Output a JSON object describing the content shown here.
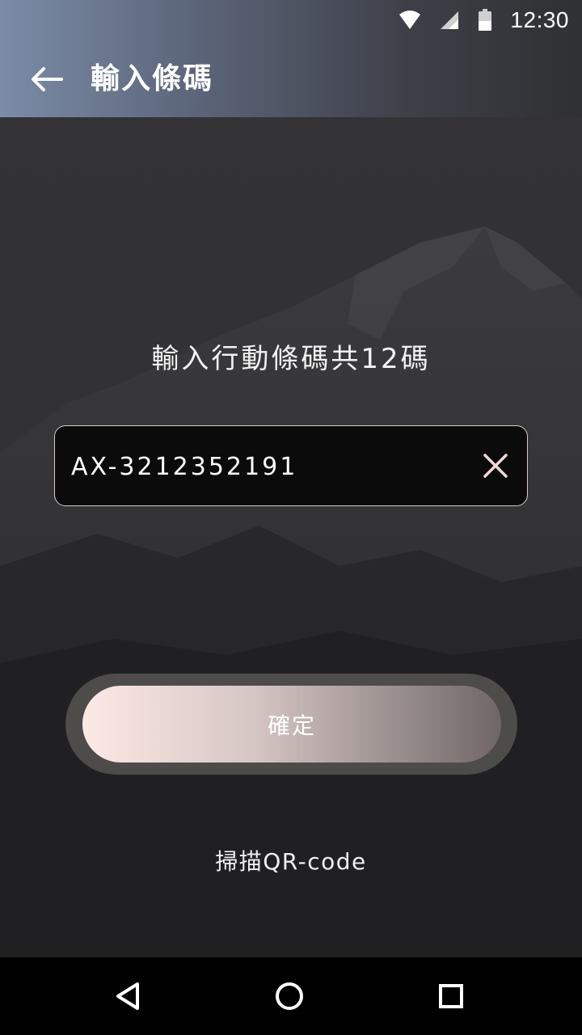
{
  "status_bar": {
    "time": "12:30",
    "icons": [
      "wifi-icon",
      "signal-icon",
      "battery-icon"
    ]
  },
  "app_bar": {
    "title": "輸入條碼",
    "back_icon": "back-arrow-icon",
    "gradient_colors": [
      "#7b8ca7",
      "#5a6377",
      "#3e4048",
      "#2f3033"
    ]
  },
  "content": {
    "prompt": "輸入行動條碼共12碼",
    "barcode_input": {
      "value": "AX-3212352191",
      "placeholder": "",
      "clear_icon": "close-icon"
    },
    "confirm_button": {
      "label": "確定",
      "gradient_colors": [
        "#fde9e6",
        "#d7c7c4",
        "#9a8f8e",
        "#6f6665"
      ]
    },
    "scan_link": "掃描QR-code"
  },
  "nav_bar": {
    "buttons": [
      "back-triangle-icon",
      "home-circle-icon",
      "recents-square-icon"
    ]
  },
  "colors": {
    "background": "#2f2f31",
    "field_border": "#d9c9c4",
    "clear_icon": "#f3d9d4"
  }
}
